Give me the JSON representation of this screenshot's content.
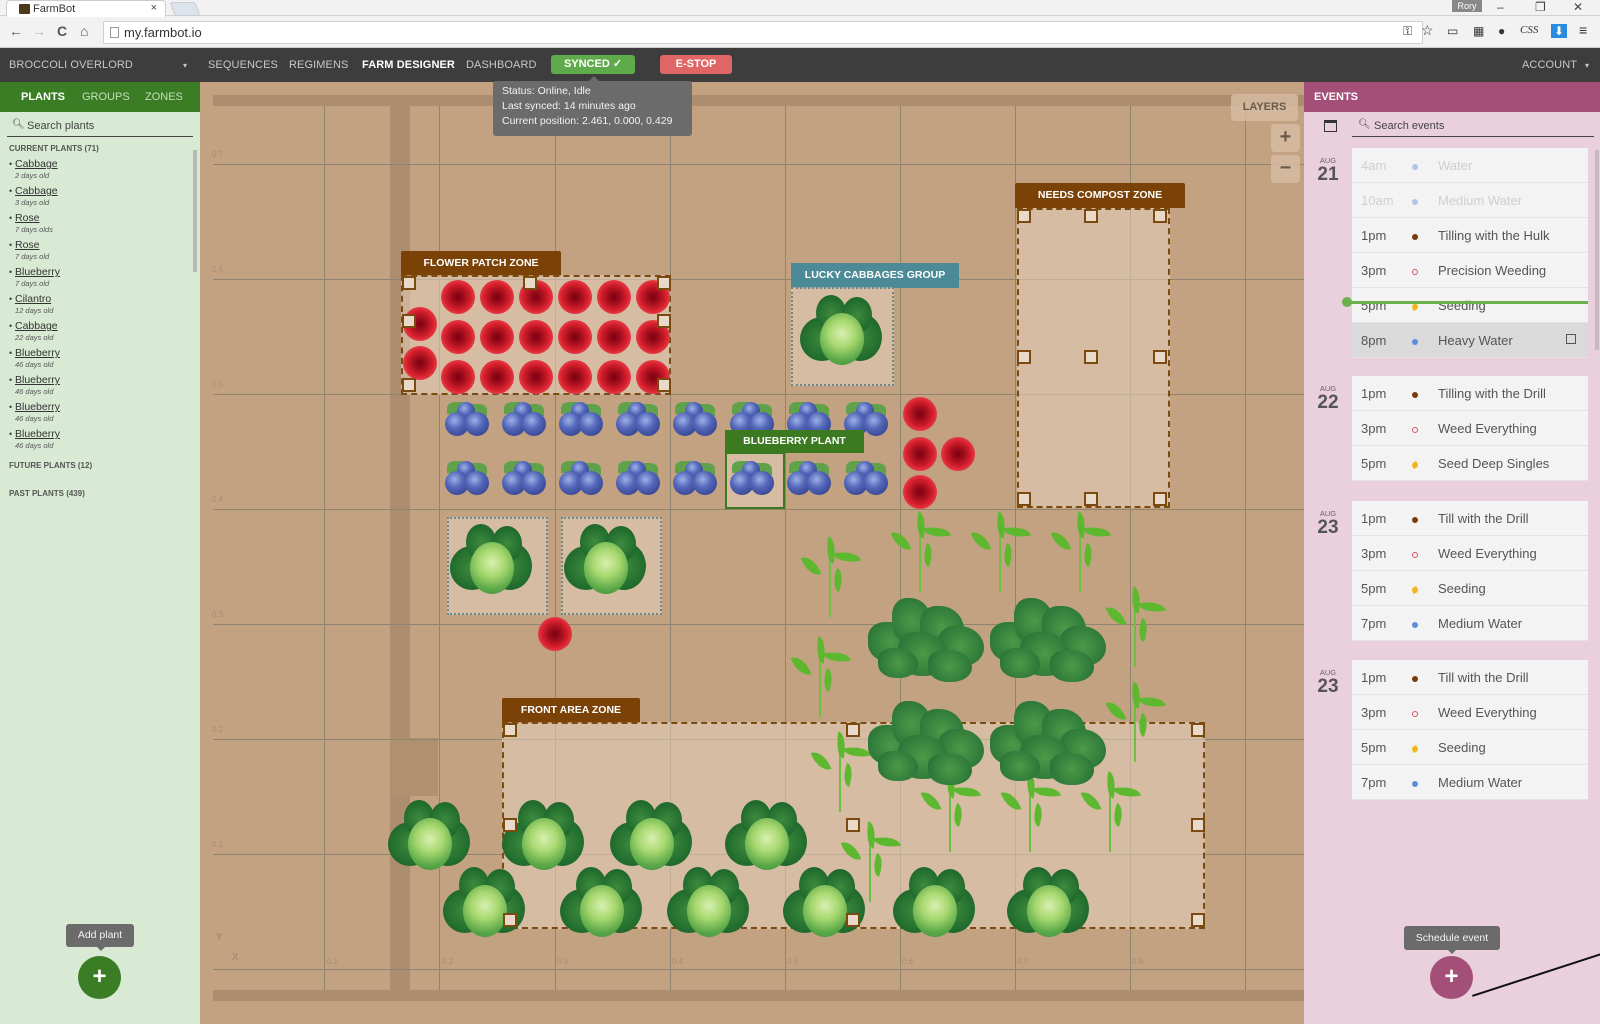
{
  "browser": {
    "tab_title": "FarmBot",
    "tab_close": "×",
    "url": "my.farmbot.io",
    "user_chip": "Rory",
    "window_controls": [
      "–",
      "❐",
      "✕"
    ],
    "nav_back": "←",
    "nav_forward": "→",
    "nav_reload": "C",
    "nav_home": "⌂",
    "extension_css": "CSS"
  },
  "appnav": {
    "farm_name": "BROCCOLI OVERLORD",
    "farm_dropdown": "▾",
    "items": [
      "SEQUENCES",
      "REGIMENS",
      "FARM DESIGNER",
      "DASHBOARD"
    ],
    "active": "FARM DESIGNER",
    "sync_button": "SYNCED ✓",
    "estop_button": "E-STOP",
    "account": "ACCOUNT",
    "account_dropdown": "▾",
    "status_tooltip": {
      "status": "Status: Online, Idle",
      "last_synced": "Last synced: 14 minutes ago",
      "position": "Current position: 2.461, 0.000, 0.429"
    }
  },
  "left_panel": {
    "tabs": [
      "PLANTS",
      "GROUPS",
      "ZONES"
    ],
    "active_tab": "PLANTS",
    "search_placeholder": "Search plants",
    "current_plants_title": "CURRENT PLANTS (71)",
    "current_plants": [
      {
        "name": "Cabbage",
        "age": "2 days old"
      },
      {
        "name": "Cabbage",
        "age": "3 days old"
      },
      {
        "name": "Rose",
        "age": "7 days olds"
      },
      {
        "name": "Rose",
        "age": "7 days old"
      },
      {
        "name": "Blueberry",
        "age": "7 days old"
      },
      {
        "name": "Cilantro",
        "age": "12 days old"
      },
      {
        "name": "Cabbage",
        "age": "22 days old"
      },
      {
        "name": "Blueberry",
        "age": "46 days old"
      },
      {
        "name": "Blueberry",
        "age": "46 days old"
      },
      {
        "name": "Blueberry",
        "age": "46 days old"
      },
      {
        "name": "Blueberry",
        "age": "46 days old"
      }
    ],
    "future_plants_title": "FUTURE PLANTS (12)",
    "past_plants_title": "PAST PLANTS (439)",
    "add_tooltip": "Add plant",
    "add_button": "+"
  },
  "map": {
    "layers_button": "LAYERS",
    "zoom_in": "+",
    "zoom_out": "−",
    "y_axis_ticks": [
      "0.7",
      "0.6",
      "0.5",
      "0.4",
      "0.3",
      "0.2",
      "0.1"
    ],
    "x_axis_ticks": [
      "0.1",
      "0.2",
      "0.3",
      "0.4",
      "0.5",
      "0.6",
      "0.7",
      "0.8"
    ],
    "axis_y": "Y",
    "axis_x": "X",
    "zones": {
      "flower_patch": "FLOWER PATCH ZONE",
      "needs_compost": "NEEDS COMPOST ZONE",
      "front_area": "FRONT AREA ZONE"
    },
    "group_label": "LUCKY CABBAGES GROUP",
    "selected_plant_label": "BLUEBERRY PLANT"
  },
  "events_panel": {
    "title": "EVENTS",
    "search_placeholder": "Search events",
    "days": [
      {
        "month": "AUG",
        "day": "21",
        "events": [
          {
            "time": "4am",
            "title": "Water",
            "type": "water",
            "past": true
          },
          {
            "time": "10am",
            "title": "Medium Water",
            "type": "water",
            "past": true
          },
          {
            "time": "1pm",
            "title": "Tilling with the Hulk",
            "type": "till"
          },
          {
            "time": "3pm",
            "title": "Precision Weeding",
            "type": "weed"
          },
          {
            "time": "5pm",
            "title": "Seeding",
            "type": "seed"
          },
          {
            "time": "8pm",
            "title": "Heavy Water",
            "type": "water",
            "hover": true
          }
        ]
      },
      {
        "month": "AUG",
        "day": "22",
        "events": [
          {
            "time": "1pm",
            "title": "Tilling with the Drill",
            "type": "till"
          },
          {
            "time": "3pm",
            "title": "Weed Everything",
            "type": "weed"
          },
          {
            "time": "5pm",
            "title": "Seed Deep Singles",
            "type": "seed"
          }
        ]
      },
      {
        "month": "AUG",
        "day": "23",
        "events": [
          {
            "time": "1pm",
            "title": "Till with the Drill",
            "type": "till"
          },
          {
            "time": "3pm",
            "title": "Weed Everything",
            "type": "weed"
          },
          {
            "time": "5pm",
            "title": "Seeding",
            "type": "seed"
          },
          {
            "time": "7pm",
            "title": "Medium Water",
            "type": "water"
          }
        ]
      },
      {
        "month": "AUG",
        "day": "23",
        "events": [
          {
            "time": "1pm",
            "title": "Till with the Drill",
            "type": "till"
          },
          {
            "time": "3pm",
            "title": "Weed Everything",
            "type": "weed"
          },
          {
            "time": "5pm",
            "title": "Seeding",
            "type": "seed"
          },
          {
            "time": "7pm",
            "title": "Medium Water",
            "type": "water"
          }
        ]
      }
    ],
    "event_type_colors": {
      "water": "#5a8fd8",
      "till": "#7a3a08",
      "weed": "#e05060",
      "seed": "#f0b820"
    },
    "schedule_tooltip": "Schedule event",
    "schedule_button": "+"
  },
  "colors": {
    "nav_bg": "#3d3d3d",
    "plants_green": "#3a7d24",
    "events_accent": "#a44f78",
    "synced": "#5fab4b",
    "estop": "#e06565",
    "zone_brown": "#7a4206",
    "group_teal": "#4c8a98"
  }
}
